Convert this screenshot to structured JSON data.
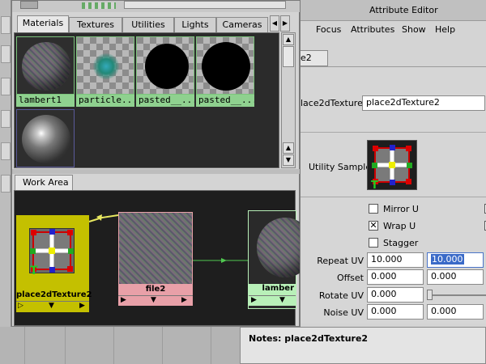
{
  "hypershade": {
    "tabs": [
      "Materials",
      "Textures",
      "Utilities",
      "Lights",
      "Cameras"
    ],
    "swatches": [
      {
        "label": "lambert1"
      },
      {
        "label": "particle..."
      },
      {
        "label": "pasted__..."
      },
      {
        "label": "pasted__..."
      },
      {
        "label": ""
      }
    ],
    "work_area_tab": "Work Area",
    "nodes": {
      "place2d": "place2dTexture2",
      "file": "file2",
      "lambert": "lamber"
    }
  },
  "attribute_editor": {
    "title": "Attribute Editor",
    "menu": [
      "Focus",
      "Attributes",
      "Show",
      "Help"
    ],
    "node_tab": "e2",
    "node_label": "lace2dTexture:",
    "node_name": "place2dTexture2",
    "utility_sample_label": "Utility Sample",
    "checkboxes": [
      {
        "label": "Mirror U",
        "checked": false
      },
      {
        "label": "Wrap U",
        "checked": true
      },
      {
        "label": "Stagger",
        "checked": false
      }
    ],
    "rows": [
      {
        "label": "Repeat UV",
        "v1": "10.000",
        "v2": "10.000"
      },
      {
        "label": "Offset",
        "v1": "0.000",
        "v2": "0.000"
      },
      {
        "label": "Rotate UV",
        "v1": "0.000"
      },
      {
        "label": "Noise UV",
        "v1": "0.000",
        "v2": "0.000"
      }
    ],
    "notes_label": "Notes:  place2dTexture2"
  },
  "colors": {
    "swatch_label_bg": "#8fd18f",
    "place2d_node": "#c4c000",
    "file_node": "#e8a0a8",
    "lambert_node": "#b8f0b8",
    "work_area_bg": "#1e1e1e"
  }
}
